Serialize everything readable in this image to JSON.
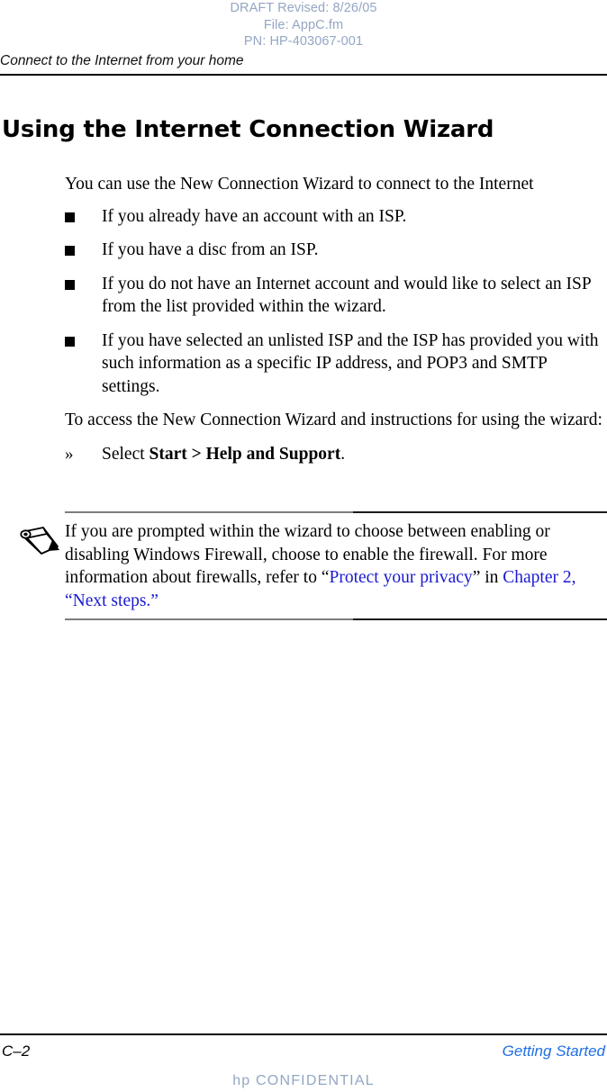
{
  "draft_header": {
    "line1": "DRAFT Revised: 8/26/05",
    "line2": "File: AppC.fm",
    "line3": "PN: HP-403067-001",
    "color": "#94a6c4"
  },
  "running_head": {
    "title": "Connect to the Internet from your home"
  },
  "section": {
    "title": "Using the Internet Connection Wizard",
    "intro": "You can use the New Connection Wizard to connect to the Internet",
    "bullets": [
      "If you already have an account with an ISP.",
      "If you have a disc from an ISP.",
      "If you do not have an Internet account and would like to select an ISP from the list provided within the wizard.",
      "If you have selected an unlisted ISP and the ISP has provided you with such information as a specific IP address, and POP3 and SMTP settings."
    ],
    "access_para": "To access the New Connection Wizard and instructions for using the wizard:",
    "step_marker": "»",
    "step_prefix": "Select ",
    "step_bold": "Start > Help and Support",
    "step_suffix": "."
  },
  "note": {
    "icon": "pencil-note-icon",
    "text_part1": "If you are prompted within the wizard to choose between enabling or disabling Windows Firewall, choose to enable the firewall. For more information about firewalls, refer to “",
    "link1": "Protect your privacy",
    "text_part2": "” in ",
    "link2": "Chapter 2, “Next steps.”",
    "link_color": "#1a1ad0"
  },
  "footer": {
    "page_number": "C–2",
    "document_name": "Getting Started",
    "confidential": "hp CONFIDENTIAL",
    "doc_color": "#1f6fe5",
    "confidential_color": "#94a6c4"
  }
}
